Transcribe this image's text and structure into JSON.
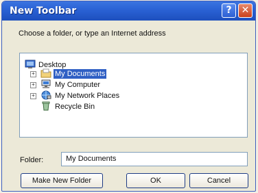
{
  "window": {
    "title": "New Toolbar",
    "help_glyph": "?",
    "close_glyph": "✕"
  },
  "prompt": "Choose a folder, or type an Internet address",
  "tree": {
    "items": [
      {
        "label": "Desktop",
        "icon": "desktop-icon",
        "expander": ""
      },
      {
        "label": "My Documents",
        "icon": "folder-icon",
        "expander": "+",
        "selected": true
      },
      {
        "label": "My Computer",
        "icon": "computer-icon",
        "expander": "+"
      },
      {
        "label": "My Network Places",
        "icon": "network-icon",
        "expander": "+"
      },
      {
        "label": "Recycle Bin",
        "icon": "recycle-bin-icon",
        "expander": ""
      }
    ]
  },
  "folder": {
    "label": "Folder:",
    "value": "My Documents"
  },
  "buttons": {
    "make_new_folder": "Make New Folder",
    "ok": "OK",
    "cancel": "Cancel"
  },
  "colors": {
    "titlebar": "#2b63d6",
    "selection": "#2f5fc4",
    "dialog_bg": "#ece9d8"
  }
}
